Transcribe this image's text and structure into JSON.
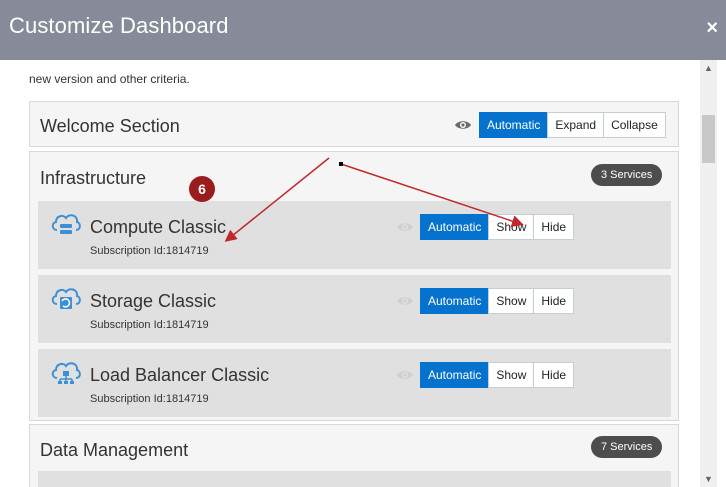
{
  "dialog": {
    "title": "Customize Dashboard",
    "close_glyph": "×"
  },
  "intro_text": "new version and other criteria.",
  "welcome": {
    "title": "Welcome Section",
    "buttons": [
      "Automatic",
      "Expand",
      "Collapse"
    ],
    "active": "Automatic",
    "eye_icon": "eye-icon"
  },
  "infrastructure": {
    "title": "Infrastructure",
    "badge": "3 Services",
    "services": [
      {
        "name": "Compute Classic",
        "sub_label": "Subscription Id:",
        "sub_value": "1814719",
        "icon": "compute-cloud-icon",
        "buttons": [
          "Automatic",
          "Show",
          "Hide"
        ]
      },
      {
        "name": "Storage Classic",
        "sub_label": "Subscription Id:",
        "sub_value": "1814719",
        "icon": "storage-cloud-icon",
        "buttons": [
          "Automatic",
          "Show",
          "Hide"
        ]
      },
      {
        "name": "Load Balancer Classic",
        "sub_label": "Subscription Id:",
        "sub_value": "1814719",
        "icon": "load-balancer-cloud-icon",
        "buttons": [
          "Automatic",
          "Show",
          "Hide"
        ]
      }
    ]
  },
  "data_management": {
    "title": "Data Management",
    "badge": "7 Services"
  },
  "annotation": {
    "step_number": "6"
  },
  "colors": {
    "title_bar": "#878b99",
    "accent_blue": "#0572ce",
    "badge": "#4d4d4d",
    "arrow_red": "#c0282d",
    "step_marker": "#9b1c1c",
    "icon_blue": "#3c91d6"
  }
}
